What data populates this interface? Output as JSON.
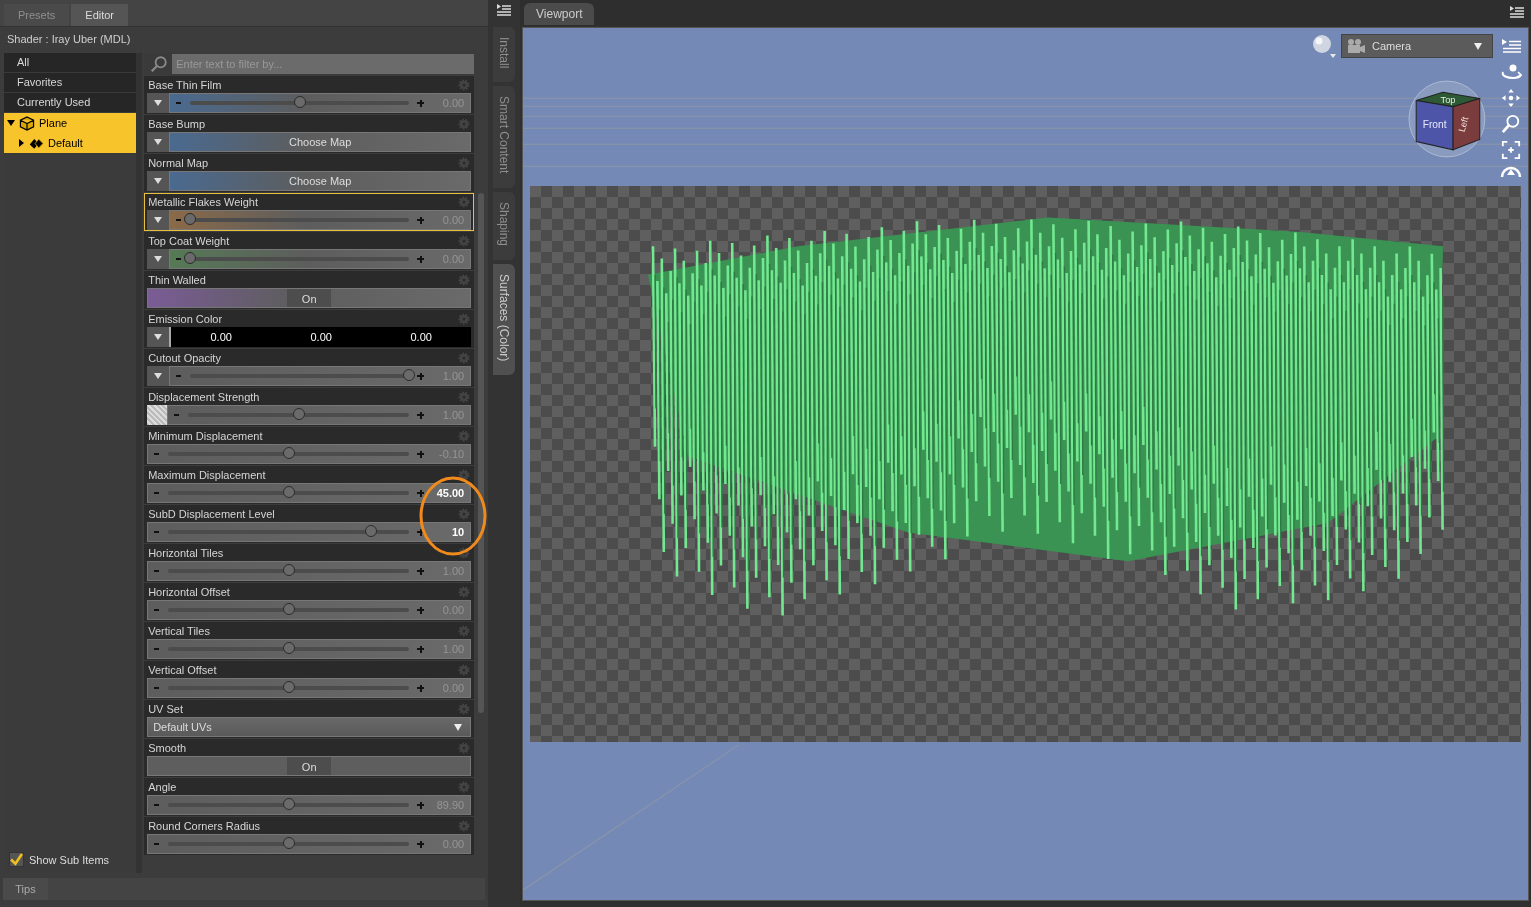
{
  "left_panel": {
    "tabs": [
      {
        "label": "Presets",
        "selected": false
      },
      {
        "label": "Editor",
        "selected": true
      }
    ],
    "shader_line": "Shader :  Iray Uber (MDL)",
    "groups": [
      {
        "label": "All",
        "selected": false
      },
      {
        "label": "Favorites",
        "selected": false
      },
      {
        "label": "Currently Used",
        "selected": false
      }
    ],
    "tree": [
      {
        "label": "Plane",
        "expanded": true,
        "selected": true,
        "children": [
          {
            "label": "Default",
            "expanded": false,
            "selected": true
          }
        ]
      }
    ],
    "show_sub_items": {
      "label": "Show Sub Items",
      "checked": true
    },
    "filter": {
      "placeholder": "Enter text to filter by..."
    },
    "properties": [
      {
        "kind": "slider",
        "label": "Base Thin Film",
        "menu_button": true,
        "value": "0.00",
        "level": 0.5,
        "color": "#4a6a90",
        "selected": false,
        "modified": false
      },
      {
        "kind": "map",
        "label": "Base Bump",
        "value": "Choose Map",
        "color": "#4a6a90",
        "selected": false
      },
      {
        "kind": "map",
        "label": "Normal Map",
        "value": "Choose Map",
        "color": "#4a6a90",
        "selected": false
      },
      {
        "kind": "slider",
        "label": "Metallic Flakes Weight",
        "menu_button": true,
        "value": "0.00",
        "level": 0,
        "color": "#8a6a48",
        "selected": true,
        "modified": false
      },
      {
        "kind": "slider",
        "label": "Top Coat Weight",
        "menu_button": true,
        "value": "0.00",
        "level": 0,
        "color": "#557a55",
        "selected": false,
        "modified": false
      },
      {
        "kind": "toggle",
        "label": "Thin Walled",
        "value": "On",
        "color": "#7a5c96",
        "selected": false
      },
      {
        "kind": "color",
        "label": "Emission Color",
        "values": [
          "0.00",
          "0.00",
          "0.00"
        ],
        "selected": false
      },
      {
        "kind": "slider",
        "label": "Cutout Opacity",
        "menu_button": true,
        "value": "1.00",
        "level": 1,
        "selected": false,
        "modified": false
      },
      {
        "kind": "slider",
        "label": "Displacement Strength",
        "texture_swatch": true,
        "value": "1.00",
        "level": 0.5,
        "selected": false,
        "modified": false
      },
      {
        "kind": "slider",
        "label": "Minimum Displacement",
        "value": "-0.10",
        "level": 0.5,
        "selected": false,
        "modified": false
      },
      {
        "kind": "slider",
        "label": "Maximum Displacement",
        "value": "45.00",
        "level": 0.5,
        "selected": false,
        "modified": true
      },
      {
        "kind": "slider",
        "label": "SubD Displacement Level",
        "value": "10",
        "level": 0.84,
        "selected": false,
        "modified": true
      },
      {
        "kind": "slider",
        "label": "Horizontal Tiles",
        "value": "1.00",
        "level": 0.5,
        "selected": false,
        "modified": false
      },
      {
        "kind": "slider",
        "label": "Horizontal Offset",
        "value": "0.00",
        "level": 0.5,
        "selected": false,
        "modified": false
      },
      {
        "kind": "slider",
        "label": "Vertical Tiles",
        "value": "1.00",
        "level": 0.5,
        "selected": false,
        "modified": false
      },
      {
        "kind": "slider",
        "label": "Vertical Offset",
        "value": "0.00",
        "level": 0.5,
        "selected": false,
        "modified": false
      },
      {
        "kind": "dropdown",
        "label": "UV Set",
        "value": "Default UVs",
        "selected": false
      },
      {
        "kind": "toggle",
        "label": "Smooth",
        "value": "On",
        "selected": false
      },
      {
        "kind": "slider",
        "label": "Angle",
        "value": "89.90",
        "level": 0.5,
        "selected": false,
        "modified": false
      },
      {
        "kind": "slider",
        "label": "Round Corners Radius",
        "value": "0.00",
        "level": 0.5,
        "selected": false,
        "modified": false
      }
    ]
  },
  "side_tabs": [
    {
      "label": "Install",
      "selected": false
    },
    {
      "label": "Smart Content",
      "selected": false
    },
    {
      "label": "Shaping",
      "selected": false
    },
    {
      "label": "Surfaces (Color)",
      "selected": true
    }
  ],
  "tips_tab": "Tips",
  "viewport": {
    "tab": "Viewport",
    "camera": "Camera",
    "view_cube": [
      "Top",
      "Front",
      "Left"
    ]
  }
}
